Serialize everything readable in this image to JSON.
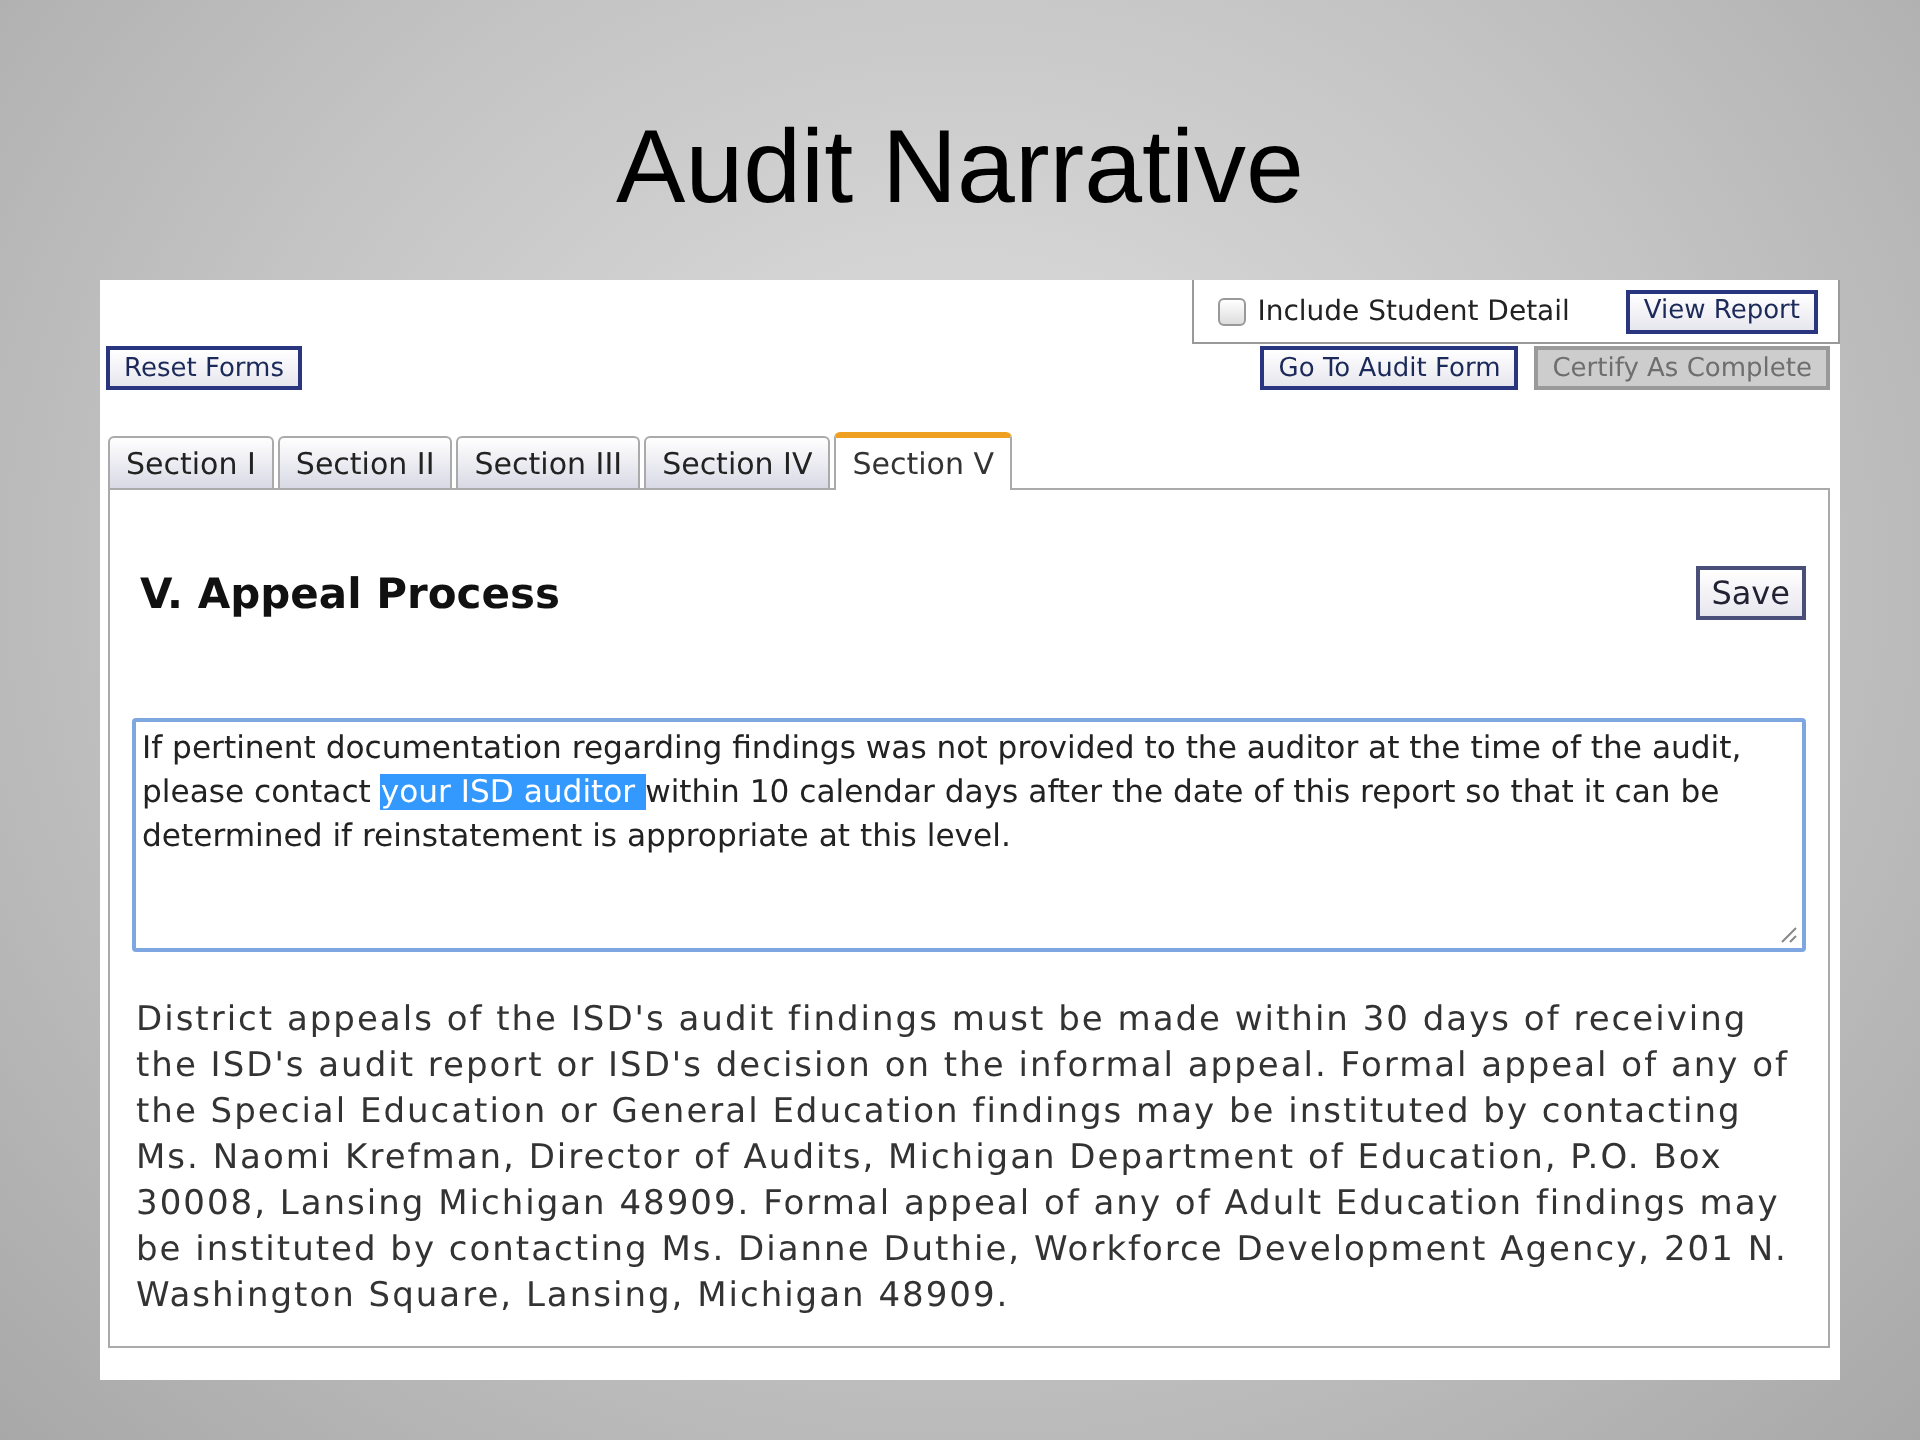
{
  "slide": {
    "title": "Audit Narrative"
  },
  "report_options": {
    "include_student_detail": {
      "label": "Include Student Detail",
      "checked": false
    },
    "view_report_button": "View Report"
  },
  "toolbar_left": [
    {
      "label": "Reset Forms",
      "disabled": false
    }
  ],
  "toolbar_right": [
    {
      "label": "Go To Audit Form",
      "disabled": false
    },
    {
      "label": "Certify As Complete",
      "disabled": true
    }
  ],
  "tabs": [
    {
      "label": "Section I",
      "selected": false
    },
    {
      "label": "Section II",
      "selected": false
    },
    {
      "label": "Section III",
      "selected": false
    },
    {
      "label": "Section IV",
      "selected": false
    },
    {
      "label": "Section V",
      "selected": true
    }
  ],
  "section": {
    "heading": "V. Appeal Process",
    "save_button": "Save",
    "textarea_segments": [
      {
        "text": "If pertinent documentation regarding findings was not provided to the auditor at the time of the audit, please contact ",
        "selected": false
      },
      {
        "text": "your ISD auditor ",
        "selected": true
      },
      {
        "text": "within 10 calendar days after the date of this report so that it can be determined if reinstatement is appropriate at this level.",
        "selected": false
      }
    ],
    "paragraph": "District appeals of the ISD's audit findings must be made within 30 days of receiving the ISD's audit report or ISD's decision on the informal appeal. Formal appeal of any of the Special Education or General Education findings may be instituted by contacting Ms. Naomi Krefman, Director of Audits, Michigan Department of Education, P.O. Box 30008, Lansing Michigan 48909. Formal appeal of any of Adult Education findings may be instituted by contacting Ms. Dianne Duthie, Workforce Development Agency, 201 N. Washington Square, Lansing, Michigan 48909."
  }
}
